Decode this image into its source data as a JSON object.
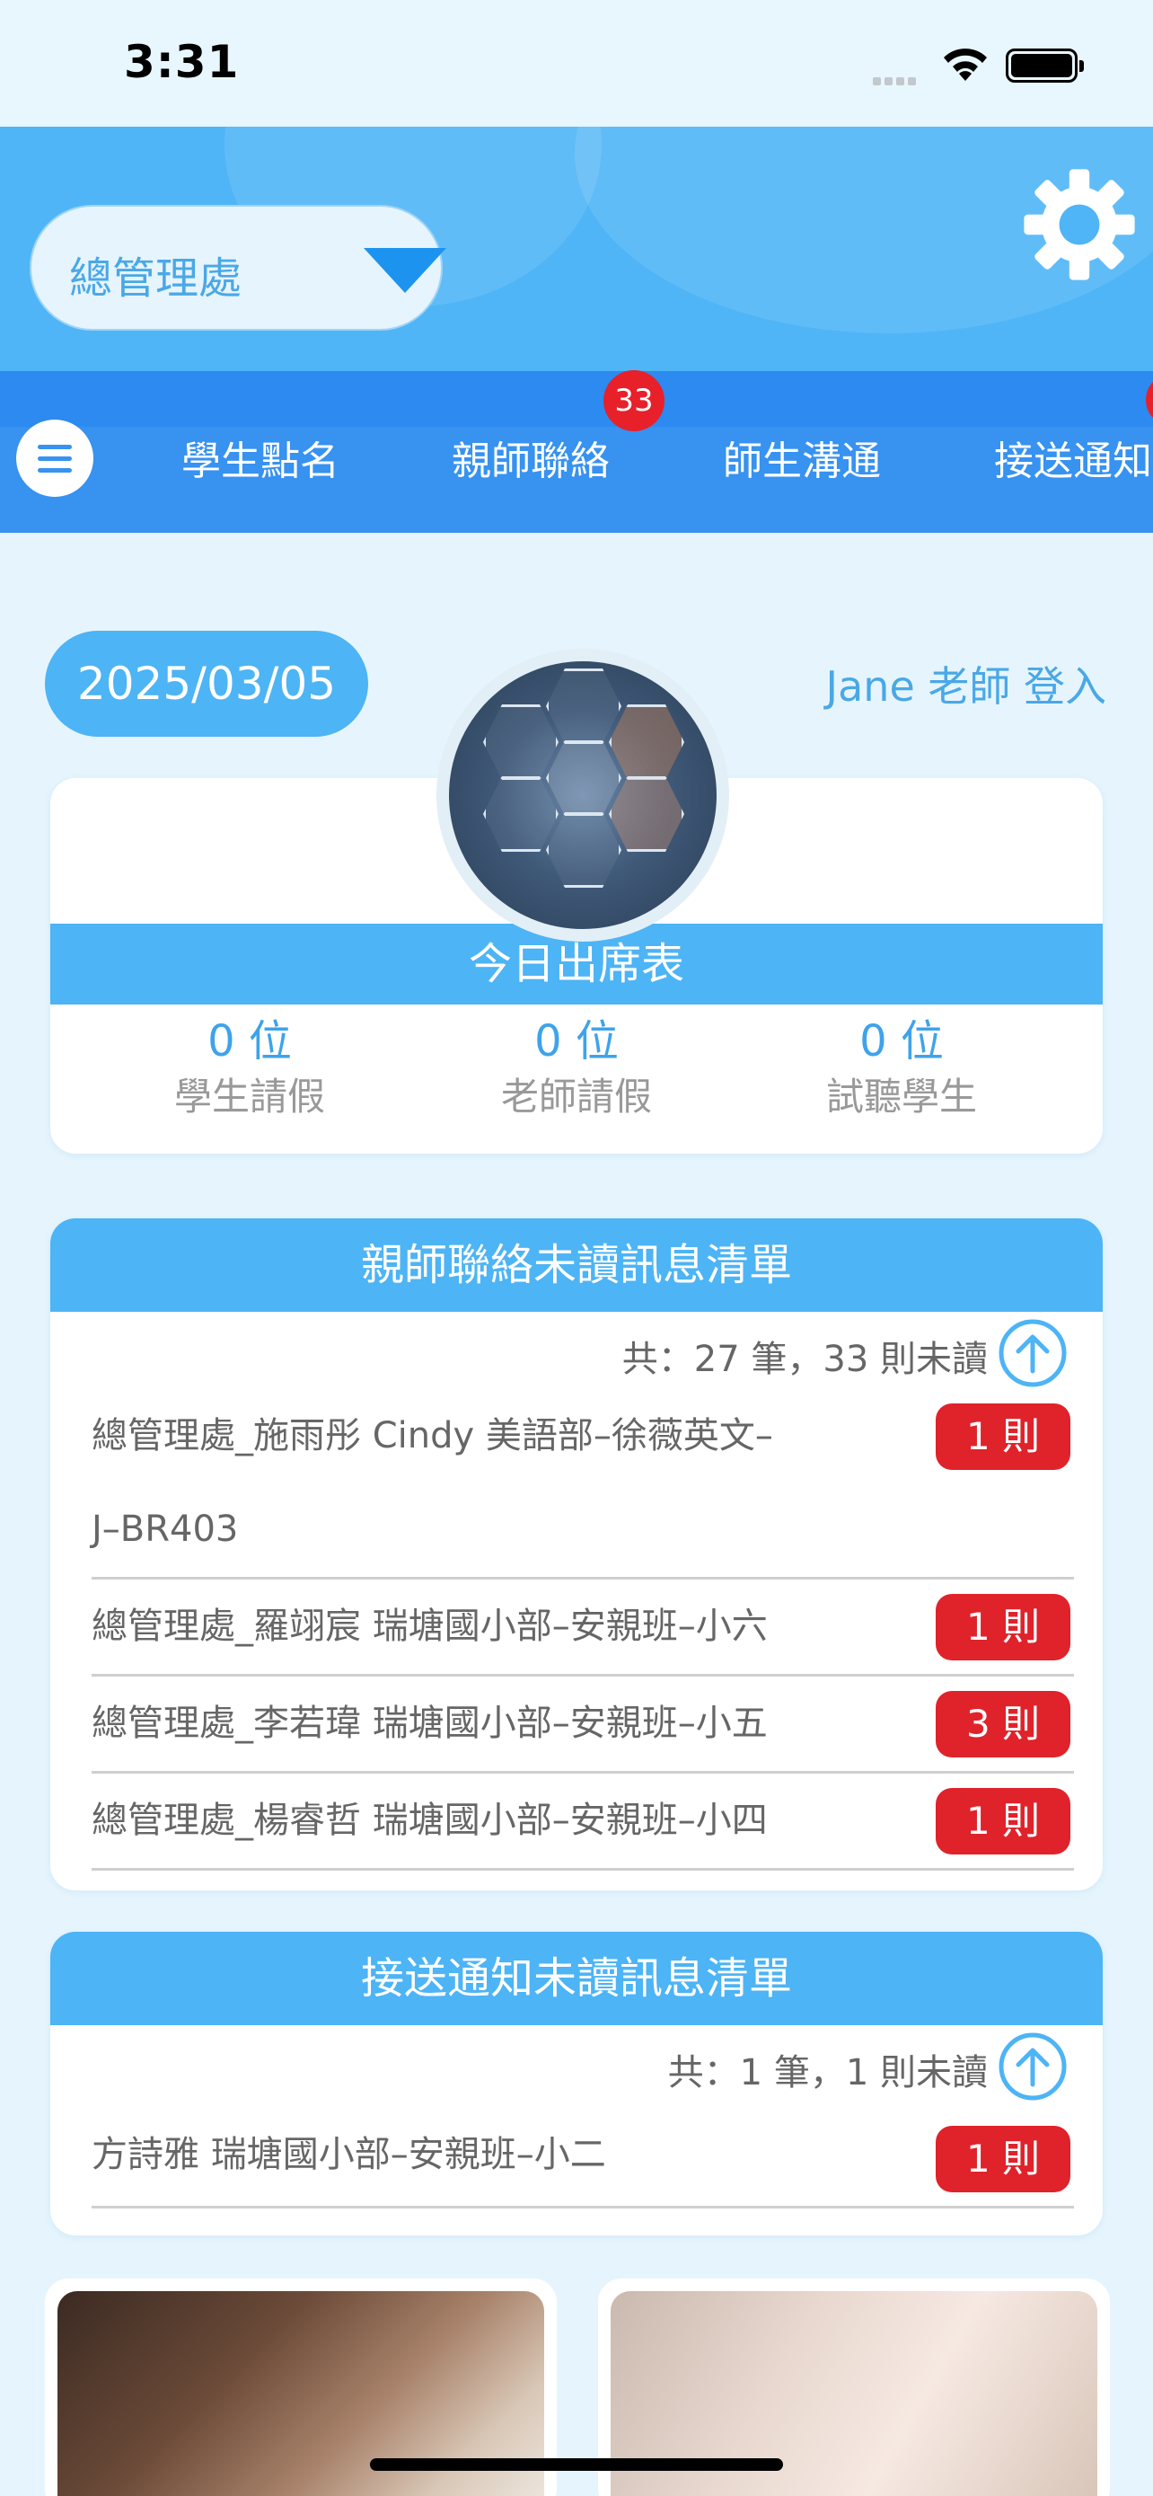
{
  "status_bar": {
    "time": "3:31"
  },
  "header": {
    "organization": "總管理處"
  },
  "tabs": [
    {
      "label": "學生點名"
    },
    {
      "label": "親師聯絡",
      "badge": "33"
    },
    {
      "label": "師生溝通"
    },
    {
      "label": "接送通知"
    }
  ],
  "date": "2025/03/05",
  "login_text": "Jane 老師 登入",
  "attendance": {
    "title": "今日出席表",
    "items": [
      {
        "value": "0 位",
        "label": "學生請假"
      },
      {
        "value": "0 位",
        "label": "老師請假"
      },
      {
        "value": "0 位",
        "label": "試聽學生"
      }
    ]
  },
  "parent_messages": {
    "title": "親師聯絡未讀訊息清單",
    "summary": "共：27 筆，33 則未讀",
    "rows": [
      {
        "name_line1": "總管理處_施雨彤 Cindy 美語部–徐薇英文–",
        "name_line2": "J–BR403",
        "count": "1 則"
      },
      {
        "name_line1": "總管理處_羅翊宸 瑞塘國小部–安親班–小六",
        "count": "1 則"
      },
      {
        "name_line1": "總管理處_李若瑋 瑞塘國小部–安親班–小五",
        "count": "3 則"
      },
      {
        "name_line1": "總管理處_楊睿哲 瑞塘國小部–安親班–小四",
        "count": "1 則"
      }
    ]
  },
  "pickup_messages": {
    "title": "接送通知未讀訊息清單",
    "summary": "共：1 筆，1 則未讀",
    "rows": [
      {
        "name_line1": "方詩雅 瑞塘國小部–安親班–小二",
        "count": "1 則"
      }
    ]
  },
  "colors": {
    "primary": "#4db4f5",
    "tab_bar": "#3792f0",
    "badge": "#e0222b",
    "background": "#e6f5fd"
  },
  "icons": [
    "gear-icon",
    "menu-icon",
    "arrow-up-circle-icon",
    "wifi-icon",
    "battery-icon",
    "signal-icon"
  ]
}
